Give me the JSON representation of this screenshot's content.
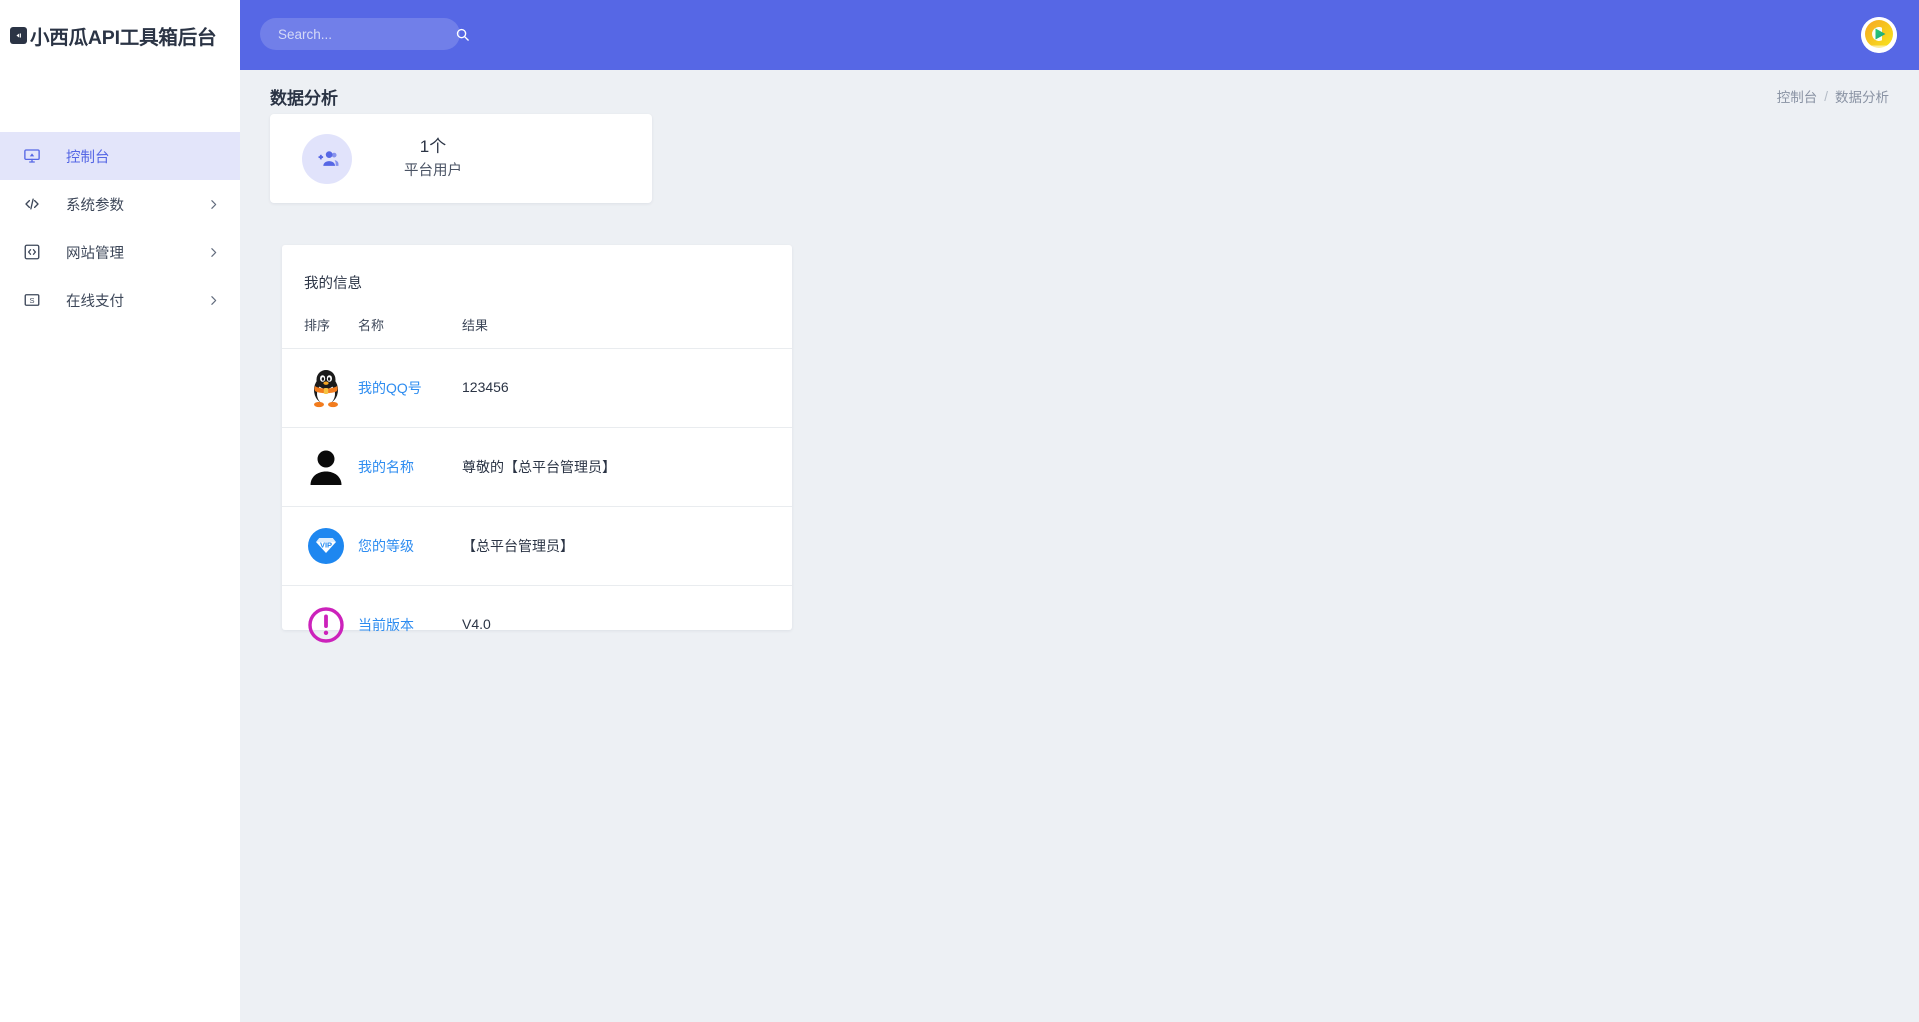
{
  "brand": {
    "icon": "box-arrow-icon",
    "title": "小西瓜API工具箱后台"
  },
  "sidebar": {
    "items": [
      {
        "label": "控制台",
        "icon": "monitor-icon",
        "active": true,
        "has_arrow": false
      },
      {
        "label": "系统参数",
        "icon": "code-icon",
        "active": false,
        "has_arrow": true
      },
      {
        "label": "网站管理",
        "icon": "code-box-icon",
        "active": false,
        "has_arrow": true
      },
      {
        "label": "在线支付",
        "icon": "money-bill-icon",
        "active": false,
        "has_arrow": true
      }
    ]
  },
  "header": {
    "search": {
      "value": "",
      "placeholder": "Search...",
      "icon": "search-icon"
    },
    "avatar": {
      "name": "user-avatar",
      "icon": "play-logo-icon"
    },
    "background": "#5667e5"
  },
  "page": {
    "title": "数据分析",
    "breadcrumb": {
      "parent": "控制台",
      "separator": "/",
      "current": "数据分析"
    }
  },
  "stat_card": {
    "icon": "add-users-icon",
    "value": "1个",
    "label": "平台用户"
  },
  "info_card": {
    "title": "我的信息",
    "columns": {
      "rank": "排序",
      "name": "名称",
      "value": "结果"
    },
    "rows": [
      {
        "icon": "qq-penguin-icon",
        "name": "我的QQ号",
        "value": "123456"
      },
      {
        "icon": "person-silhouette-icon",
        "name": "我的名称",
        "value": "尊敬的【总平台管理员】"
      },
      {
        "icon": "vip-diamond-icon",
        "name": "您的等级",
        "value": "【总平台管理员】"
      },
      {
        "icon": "exclamation-circle-icon",
        "name": "当前版本",
        "value": "V4.0"
      }
    ]
  },
  "colors": {
    "accent": "#5667e5",
    "active_nav_bg": "#e3e5fa",
    "content_bg": "#edf0f4",
    "link": "#2d8cf0"
  }
}
